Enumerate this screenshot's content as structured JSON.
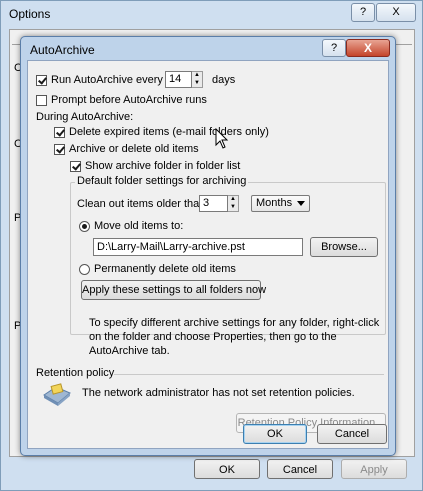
{
  "options_window": {
    "title": "Options",
    "help_button": "?",
    "close_button": "X",
    "fragments": [
      "C",
      "C",
      "P",
      "P"
    ],
    "buttons": {
      "ok": "OK",
      "cancel": "Cancel",
      "apply": "Apply"
    }
  },
  "dialog": {
    "title": "AutoArchive",
    "help_button": "?",
    "close_button": "X",
    "run_every": {
      "label": "Run AutoArchive every",
      "value": "14",
      "unit": "days",
      "checked": true
    },
    "prompt_before": {
      "label": "Prompt before AutoArchive runs",
      "checked": false
    },
    "during_label": "During AutoArchive:",
    "delete_expired": {
      "label": "Delete expired items (e-mail folders only)",
      "checked": true
    },
    "archive_old": {
      "label": "Archive or delete old items",
      "checked": true
    },
    "show_archive": {
      "label": "Show archive folder in folder list",
      "checked": true
    },
    "defaults_group": {
      "title": "Default folder settings for archiving",
      "clean_out_label": "Clean out items older than",
      "clean_out_value": "3",
      "period": "Months",
      "move_old": {
        "label": "Move old items to:",
        "selected": true
      },
      "path": "D:\\Larry-Mail\\Larry-archive.pst",
      "browse": "Browse...",
      "permanently_delete": {
        "label": "Permanently delete old items",
        "selected": false
      },
      "apply_all": "Apply these settings to all folders now"
    },
    "info_text": "To specify different archive settings for any folder, right-click on the folder and choose Properties, then go to the AutoArchive tab.",
    "retention": {
      "title": "Retention policy",
      "message": "The network administrator has not set retention policies.",
      "info_button": "Retention Policy Information..."
    },
    "ok": "OK",
    "cancel": "Cancel"
  }
}
